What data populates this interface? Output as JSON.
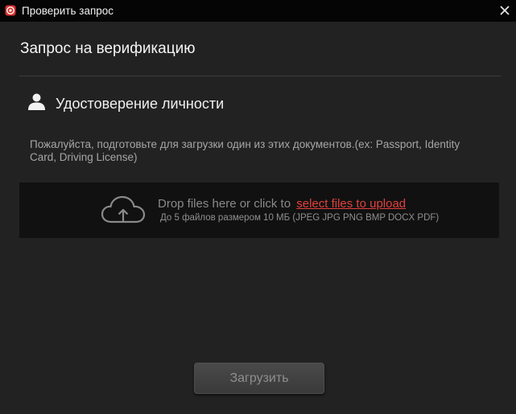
{
  "window": {
    "title": "Проверить запрос",
    "app_icon": "red-logo-icon",
    "close_icon": "close-icon"
  },
  "dialog": {
    "heading": "Запрос на верификацию"
  },
  "section": {
    "icon": "user-icon",
    "title": "Удостоверение личности",
    "instructions": "Пожалуйста, подготовьте для загрузки один из этих документов.(ex: Passport, Identity Card, Driving License)"
  },
  "dropzone": {
    "icon": "cloud-upload-icon",
    "prompt": "Drop files here or click to",
    "link_text": "select files to upload",
    "limits": "До 5 файлов размером 10 МБ (JPEG JPG PNG BMP DOCX PDF)"
  },
  "footer": {
    "upload_label": "Загрузить"
  },
  "colors": {
    "background": "#222222",
    "titlebar": "#050505",
    "dropzone": "#111111",
    "link": "#e2403d",
    "button": "#3f3f3f"
  }
}
